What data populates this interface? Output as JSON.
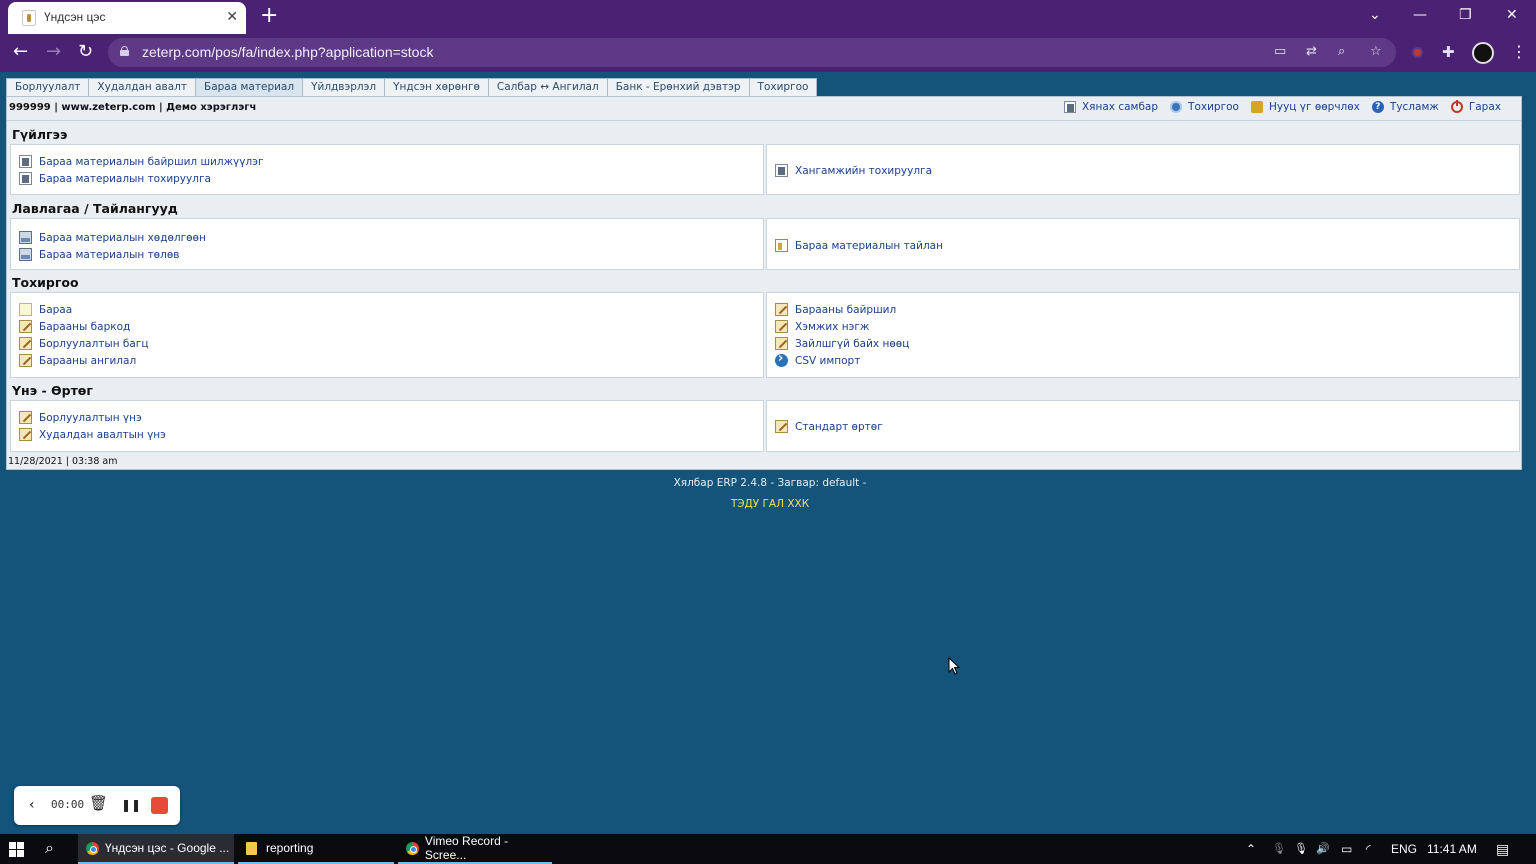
{
  "browser": {
    "tab_title": "Үндсэн цэс",
    "tab_close": "✕",
    "new_tab": "+",
    "url": "zeterp.com/pos/fa/index.php?application=stock",
    "controls": {
      "dropdown": "⌄",
      "minimize": "—",
      "restore": "❐",
      "close": "✕"
    },
    "nav": {
      "back": "←",
      "forward": "→",
      "reload": "↻"
    },
    "icons": {
      "camera": "▭",
      "translate": "⇄",
      "zoom": "⌕",
      "star": "☆",
      "puzzle": "✚",
      "menu": "⋮"
    }
  },
  "app_tabs": [
    {
      "label": "Борлуулалт",
      "active": false
    },
    {
      "label": "Худалдан авалт",
      "active": false
    },
    {
      "label": "Бараа материал",
      "active": true
    },
    {
      "label": "Үйлдвэрлэл",
      "active": false
    },
    {
      "label": "Үндсэн хөрөнгө",
      "active": false
    },
    {
      "label": "Салбар ↔ Ангилал",
      "active": false
    },
    {
      "label": "Банк - Ерөнхий дэвтэр",
      "active": false
    },
    {
      "label": "Тохиргоо",
      "active": false
    }
  ],
  "header": {
    "company": "999999 | www.zeterp.com | Демо хэрэглэгч",
    "links": [
      {
        "label": "Хянах самбар",
        "icon": "dashboard-icon"
      },
      {
        "label": "Тохиргоо",
        "icon": "gear-icon"
      },
      {
        "label": "Нууц үг өөрчлөх",
        "icon": "lock-icon"
      },
      {
        "label": "Тусламж",
        "icon": "help-icon"
      },
      {
        "label": "Гарах",
        "icon": "power-icon"
      }
    ]
  },
  "sections": [
    {
      "title": "Гүйлгээ",
      "left": [
        {
          "label": "Бараа материалын байршил шилжүүлэг",
          "icon": "doc"
        },
        {
          "label": "Бараа материалын тохируулга",
          "icon": "doc"
        }
      ],
      "right": [
        {
          "label": "Хангамжийн тохируулга",
          "icon": "doc"
        }
      ]
    },
    {
      "title": "Лавлагаа / Тайлангууд",
      "left": [
        {
          "label": "Бараа материалын хөдөлгөөн",
          "icon": "stack"
        },
        {
          "label": "Бараа материалын төлөв",
          "icon": "stack"
        }
      ],
      "right": [
        {
          "label": "Бараа материалын тайлан",
          "icon": "report"
        }
      ]
    },
    {
      "title": "Тохиргоо",
      "left": [
        {
          "label": "Бараа",
          "icon": "note"
        },
        {
          "label": "Барааны баркод",
          "icon": "edit"
        },
        {
          "label": "Борлуулалтын багц",
          "icon": "edit"
        },
        {
          "label": "Барааны ангилал",
          "icon": "edit"
        }
      ],
      "right": [
        {
          "label": "Барааны байршил",
          "icon": "edit"
        },
        {
          "label": "Хэмжих нэгж",
          "icon": "edit"
        },
        {
          "label": "Зайлшгүй байх нөөц",
          "icon": "edit"
        },
        {
          "label": "CSV импорт",
          "icon": "arrow"
        }
      ]
    },
    {
      "title": "Үнэ - Өртөг",
      "left": [
        {
          "label": "Борлуулалтын үнэ",
          "icon": "edit"
        },
        {
          "label": "Худалдан авалтын үнэ",
          "icon": "edit"
        }
      ],
      "right": [
        {
          "label": "Стандарт өртөг",
          "icon": "edit"
        }
      ]
    }
  ],
  "timestamp": "11/28/2021 | 03:38 am",
  "footer": {
    "version": "Хялбар ERP 2.4.8 - Загвар: default -",
    "company": "ТЭДУ ГАЛ ХХК"
  },
  "recorder": {
    "time": "00:00",
    "back": "‹",
    "trash": "🗑",
    "pause": "❚❚"
  },
  "taskbar": {
    "apps": [
      {
        "label": "Үндсэн цэс - Google ...",
        "icon": "chrome-icon"
      },
      {
        "label": "reporting",
        "icon": "folder-icon"
      },
      {
        "label": "Vimeo Record - Scree...",
        "icon": "chrome-icon"
      }
    ],
    "tray": {
      "chevron": "⌃",
      "mic": "🎙",
      "volume": "🔊",
      "lang": "ENG",
      "time": "11:41 AM",
      "notification": "▤"
    }
  }
}
